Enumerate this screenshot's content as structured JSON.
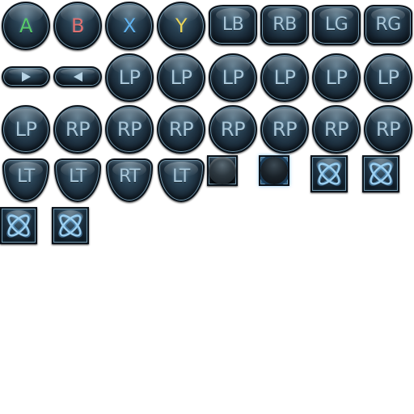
{
  "sheet": {
    "title": "",
    "accent_color": "#a9c6d8",
    "buttons": [
      {
        "id": "a",
        "kind": "round",
        "label": "A",
        "color": "#58c96a"
      },
      {
        "id": "b",
        "kind": "round",
        "label": "B",
        "color": "#e07272"
      },
      {
        "id": "x",
        "kind": "round",
        "label": "X",
        "color": "#5fb1ee"
      },
      {
        "id": "y",
        "kind": "round",
        "label": "Y",
        "color": "#e8d45a"
      },
      {
        "id": "lb",
        "kind": "bumper",
        "side": "left",
        "label": "LB",
        "color": "#a9c6d8"
      },
      {
        "id": "rb",
        "kind": "bumper",
        "side": "right",
        "label": "RB",
        "color": "#a9c6d8"
      },
      {
        "id": "lg",
        "kind": "bumper",
        "side": "left",
        "label": "LG",
        "color": "#a9c6d8"
      },
      {
        "id": "rg",
        "kind": "bumper",
        "side": "right",
        "label": "RG",
        "color": "#a9c6d8"
      },
      {
        "id": "start",
        "kind": "pill",
        "icon": "play-right-icon",
        "dir": "right"
      },
      {
        "id": "back",
        "kind": "pill",
        "icon": "play-left-icon",
        "dir": "left"
      },
      {
        "id": "lp-1",
        "kind": "round",
        "label": "LP",
        "color": "#a9c6d8"
      },
      {
        "id": "lp-2",
        "kind": "round",
        "label": "LP",
        "color": "#a9c6d8"
      },
      {
        "id": "lp-3",
        "kind": "round",
        "label": "LP",
        "color": "#a9c6d8"
      },
      {
        "id": "lp-4",
        "kind": "round",
        "label": "LP",
        "color": "#a9c6d8"
      },
      {
        "id": "lp-5",
        "kind": "round",
        "label": "LP",
        "color": "#a9c6d8"
      },
      {
        "id": "lp-6",
        "kind": "round",
        "label": "LP",
        "color": "#a9c6d8"
      },
      {
        "id": "lp-7",
        "kind": "round",
        "label": "LP",
        "color": "#a9c6d8"
      },
      {
        "id": "rp-1",
        "kind": "round",
        "label": "RP",
        "color": "#a9c6d8"
      },
      {
        "id": "rp-2",
        "kind": "round",
        "label": "RP",
        "color": "#a9c6d8"
      },
      {
        "id": "rp-3",
        "kind": "round",
        "label": "RP",
        "color": "#a9c6d8"
      },
      {
        "id": "rp-4",
        "kind": "round",
        "label": "RP",
        "color": "#a9c6d8"
      },
      {
        "id": "rp-5",
        "kind": "round",
        "label": "RP",
        "color": "#a9c6d8"
      },
      {
        "id": "rp-6",
        "kind": "round",
        "label": "RP",
        "color": "#a9c6d8"
      },
      {
        "id": "rp-7",
        "kind": "round",
        "label": "RP",
        "color": "#a9c6d8"
      },
      {
        "id": "lt-1",
        "kind": "trigger",
        "label": "LT",
        "color": "#a9c6d8"
      },
      {
        "id": "lt-2",
        "kind": "trigger",
        "label": "LT",
        "color": "#a9c6d8"
      },
      {
        "id": "rt",
        "kind": "trigger",
        "label": "RT",
        "color": "#a9c6d8"
      },
      {
        "id": "lt-3",
        "kind": "trigger",
        "label": "LT",
        "color": "#a9c6d8"
      },
      {
        "id": "stick-plain",
        "kind": "stick",
        "icon": "thumbstick-icon",
        "ring": false
      },
      {
        "id": "stick-ring",
        "kind": "stick",
        "icon": "thumbstick-pressed-icon",
        "ring": true
      },
      {
        "id": "guide-1",
        "kind": "guide",
        "icon": "guide-atom-icon"
      },
      {
        "id": "guide-2",
        "kind": "guide",
        "icon": "guide-atom-icon"
      },
      {
        "id": "guide-3",
        "kind": "guide",
        "icon": "guide-atom-icon"
      },
      {
        "id": "guide-4",
        "kind": "guide",
        "icon": "guide-atom-icon"
      }
    ]
  }
}
